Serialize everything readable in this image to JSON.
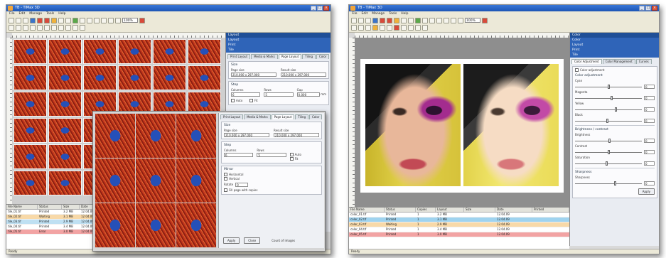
{
  "left_window": {
    "title": "TB - TiMax 3D",
    "menu": [
      "File",
      "Edit",
      "Manage",
      "Tools",
      "Help"
    ],
    "zoom_value": "100%",
    "panel_title": "Layout",
    "panel_items": [
      "Layout",
      "Print",
      "Tile"
    ],
    "tabs": [
      "Print Layout",
      "Media & Marks",
      "Page Layout",
      "Tiling",
      "Color"
    ],
    "size_group": {
      "title": "Size",
      "page_size_label": "Page size",
      "page_size_value": "210.000 x 297.000",
      "result_size_label": "Result size",
      "result_size_value": "210.000 x 297.000"
    },
    "step_group": {
      "title": "Step",
      "columns_label": "Columns",
      "columns_value": "6",
      "rows_label": "Rows",
      "rows_value": "5",
      "gap_label": "Gap",
      "gap_value": "0.000",
      "gap_unit": "mm",
      "auto_label": "Auto",
      "fit_label": "Fit"
    },
    "file_list": {
      "columns": [
        "File Name",
        "Status",
        "Size",
        "Date"
      ],
      "rows": [
        {
          "name": "tile_01.tif",
          "status": "Printed",
          "size": "3.2 MB",
          "date": "12.04.09"
        },
        {
          "name": "tile_02.tif",
          "status": "Waiting",
          "size": "3.1 MB",
          "date": "12.04.09"
        },
        {
          "name": "tile_03.tif",
          "status": "Printed",
          "size": "2.9 MB",
          "date": "12.04.09"
        },
        {
          "name": "tile_04.tif",
          "status": "Printed",
          "size": "3.4 MB",
          "date": "12.04.09"
        },
        {
          "name": "tile_05.tif",
          "status": "Error",
          "size": "3.0 MB",
          "date": "12.04.09"
        }
      ]
    },
    "status_text": "Ready"
  },
  "dialog": {
    "tabs": [
      "Print Layout",
      "Media & Marks",
      "Page Layout",
      "Tiling",
      "Color"
    ],
    "size_title": "Size",
    "page_size_label": "Page size",
    "page_size_value": "210.000 x 297.000",
    "result_size_label": "Result size",
    "result_size_value": "210.000 x 297.000",
    "step_title": "Step",
    "columns_label": "Columns",
    "columns_value": "6",
    "rows_label": "Rows",
    "rows_value": "5",
    "auto_label": "Auto",
    "fit_label": "Fit",
    "mirror_title": "Mirror",
    "mirror_h_label": "Horizontal",
    "mirror_v_label": "Vertical",
    "rotate_label": "Rotate",
    "rotate_value": "0",
    "fill_label": "Fill page with copies",
    "apply_label": "Apply",
    "close_label": "Close",
    "count_label": "Count of images"
  },
  "right_window": {
    "title": "TB - TiMax 3D",
    "menu": [
      "File",
      "Edit",
      "Manage",
      "Tools",
      "Help"
    ],
    "zoom_value": "100%",
    "panel_title": "Color",
    "panel_items": [
      "Color",
      "Layout",
      "Print",
      "Tile"
    ],
    "tabs": [
      "Color Adjustment",
      "Color Management",
      "Curves"
    ],
    "enable_label": "Color adjustment",
    "group1_title": "Color adjustment",
    "sliders1": [
      {
        "label": "Cyan",
        "value": "0",
        "pos": 0.5
      },
      {
        "label": "Magenta",
        "value": "0",
        "pos": 0.55
      },
      {
        "label": "Yellow",
        "value": "0",
        "pos": 0.62
      },
      {
        "label": "Black",
        "value": "0",
        "pos": 0.48
      }
    ],
    "group2_title": "Brightness / contrast",
    "sliders2": [
      {
        "label": "Brightness",
        "value": "0",
        "pos": 0.52
      },
      {
        "label": "Contrast",
        "value": "0",
        "pos": 0.5
      },
      {
        "label": "Saturation",
        "value": "0",
        "pos": 0.47
      }
    ],
    "group3_title": "Sharpness",
    "sliders3": [
      {
        "label": "Sharpness",
        "value": "0",
        "pos": 0.6
      }
    ],
    "apply_label": "Apply",
    "file_list": {
      "columns": [
        "File Name",
        "Status",
        "Copies",
        "Layout",
        "Size",
        "Date",
        "Printed"
      ],
      "rows": [
        {
          "name": "color_01.tif",
          "status": "Printed",
          "copies": "1",
          "size": "3.2 MB",
          "date": "12.04.09"
        },
        {
          "name": "color_02.tif",
          "status": "Printed",
          "copies": "1",
          "size": "3.1 MB",
          "date": "12.04.09"
        },
        {
          "name": "color_03.tif",
          "status": "Waiting",
          "copies": "1",
          "size": "2.9 MB",
          "date": "12.04.09"
        },
        {
          "name": "color_04.tif",
          "status": "Printed",
          "copies": "1",
          "size": "3.4 MB",
          "date": "12.04.09"
        },
        {
          "name": "color_05.tif",
          "status": "Printed",
          "copies": "1",
          "size": "3.0 MB",
          "date": "12.04.09"
        }
      ]
    },
    "status_text": "Ready"
  }
}
